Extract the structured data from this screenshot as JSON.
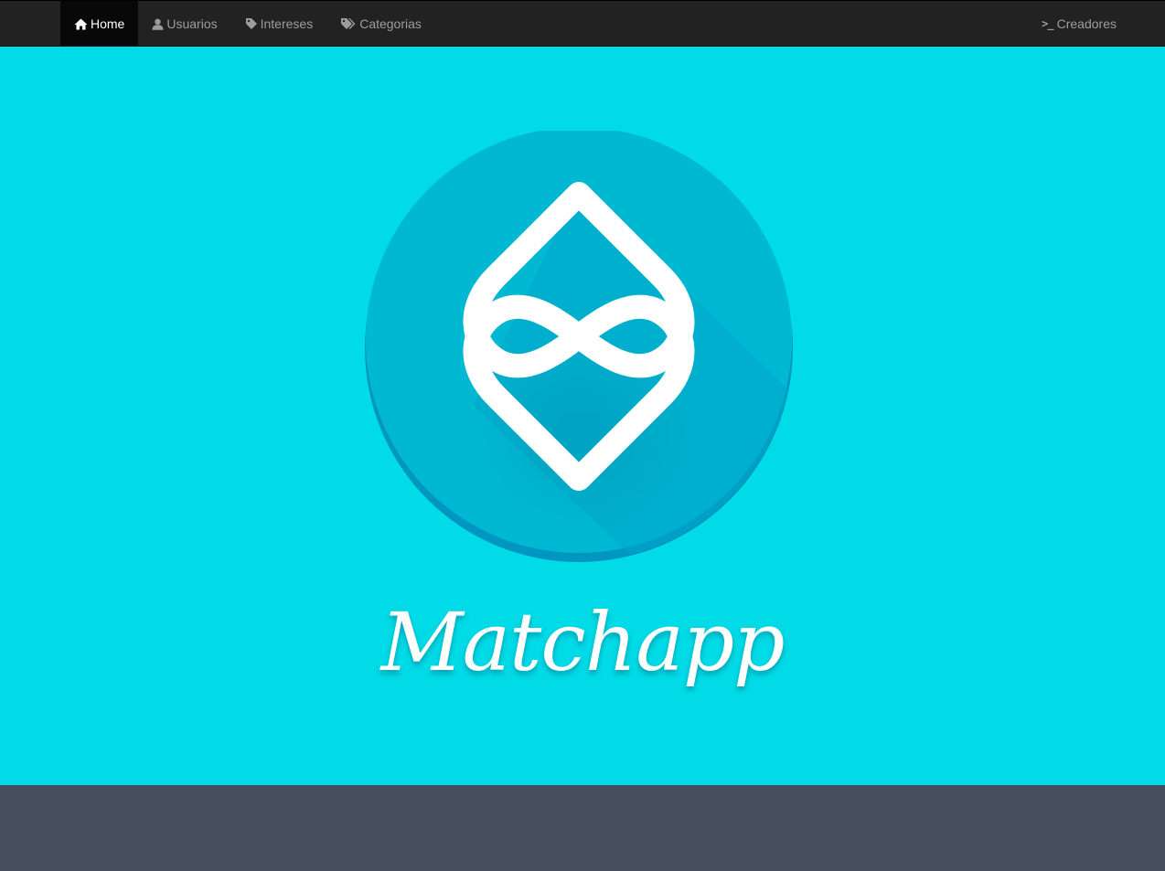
{
  "nav": {
    "left_items": [
      {
        "label": "Home",
        "icon": "home-icon",
        "active": true
      },
      {
        "label": "Usuarios",
        "icon": "user-icon",
        "active": false
      },
      {
        "label": "Intereses",
        "icon": "tag-icon",
        "active": false
      },
      {
        "label": "Categorias",
        "icon": "tags-icon",
        "active": false
      }
    ],
    "right_items": [
      {
        "label": "Creadores",
        "icon": "terminal-icon",
        "active": false
      }
    ]
  },
  "hero": {
    "brand_name": "Matchapp",
    "logo_icon": "matchapp-logo-icon"
  },
  "colors": {
    "navbar_bg": "#222222",
    "nav_active_bg": "#080808",
    "nav_text": "#9d9d9d",
    "hero_bg": "#00dbe7",
    "logo_circle": "#00b8d4",
    "footer_bg": "#474f5f"
  }
}
